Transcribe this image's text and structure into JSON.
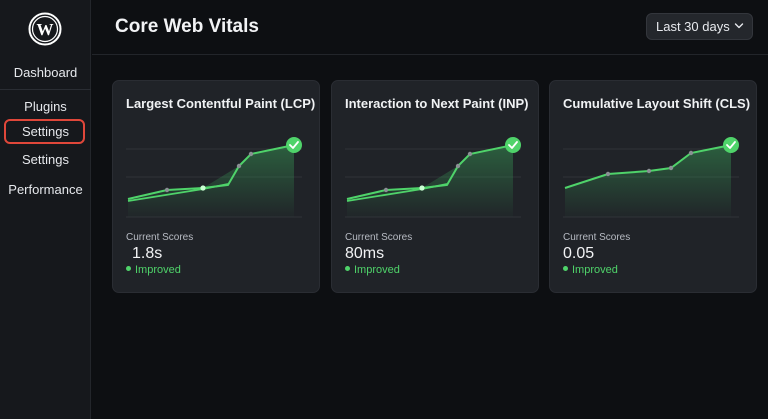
{
  "sidebar": {
    "items": [
      {
        "label": "Dashboard"
      },
      {
        "label": "Plugins"
      },
      {
        "label": "Settings"
      },
      {
        "label": "Settings"
      },
      {
        "label": "Performance"
      }
    ]
  },
  "header": {
    "title": "Core Web Vitals",
    "range_label": "Last 30 days"
  },
  "cards": [
    {
      "title": "Largest Contentful Paint (LCP)",
      "score_label": "Current Scores",
      "score": "1.8s",
      "status": "Improved"
    },
    {
      "title": "Interaction to Next Paint (INP)",
      "score_label": "Current Scores",
      "score": "80ms",
      "status": "Improved"
    },
    {
      "title": "Cumulative Layout Shift (CLS)",
      "score_label": "Current Scores",
      "score": "0.05",
      "status": "Improved"
    }
  ],
  "colors": {
    "accent_green": "#4fd36a",
    "highlight_red": "#e0473a"
  },
  "icons": {
    "logo": "wordpress-logo",
    "range": "chevron-down-icon",
    "badge": "check-circle-icon"
  }
}
